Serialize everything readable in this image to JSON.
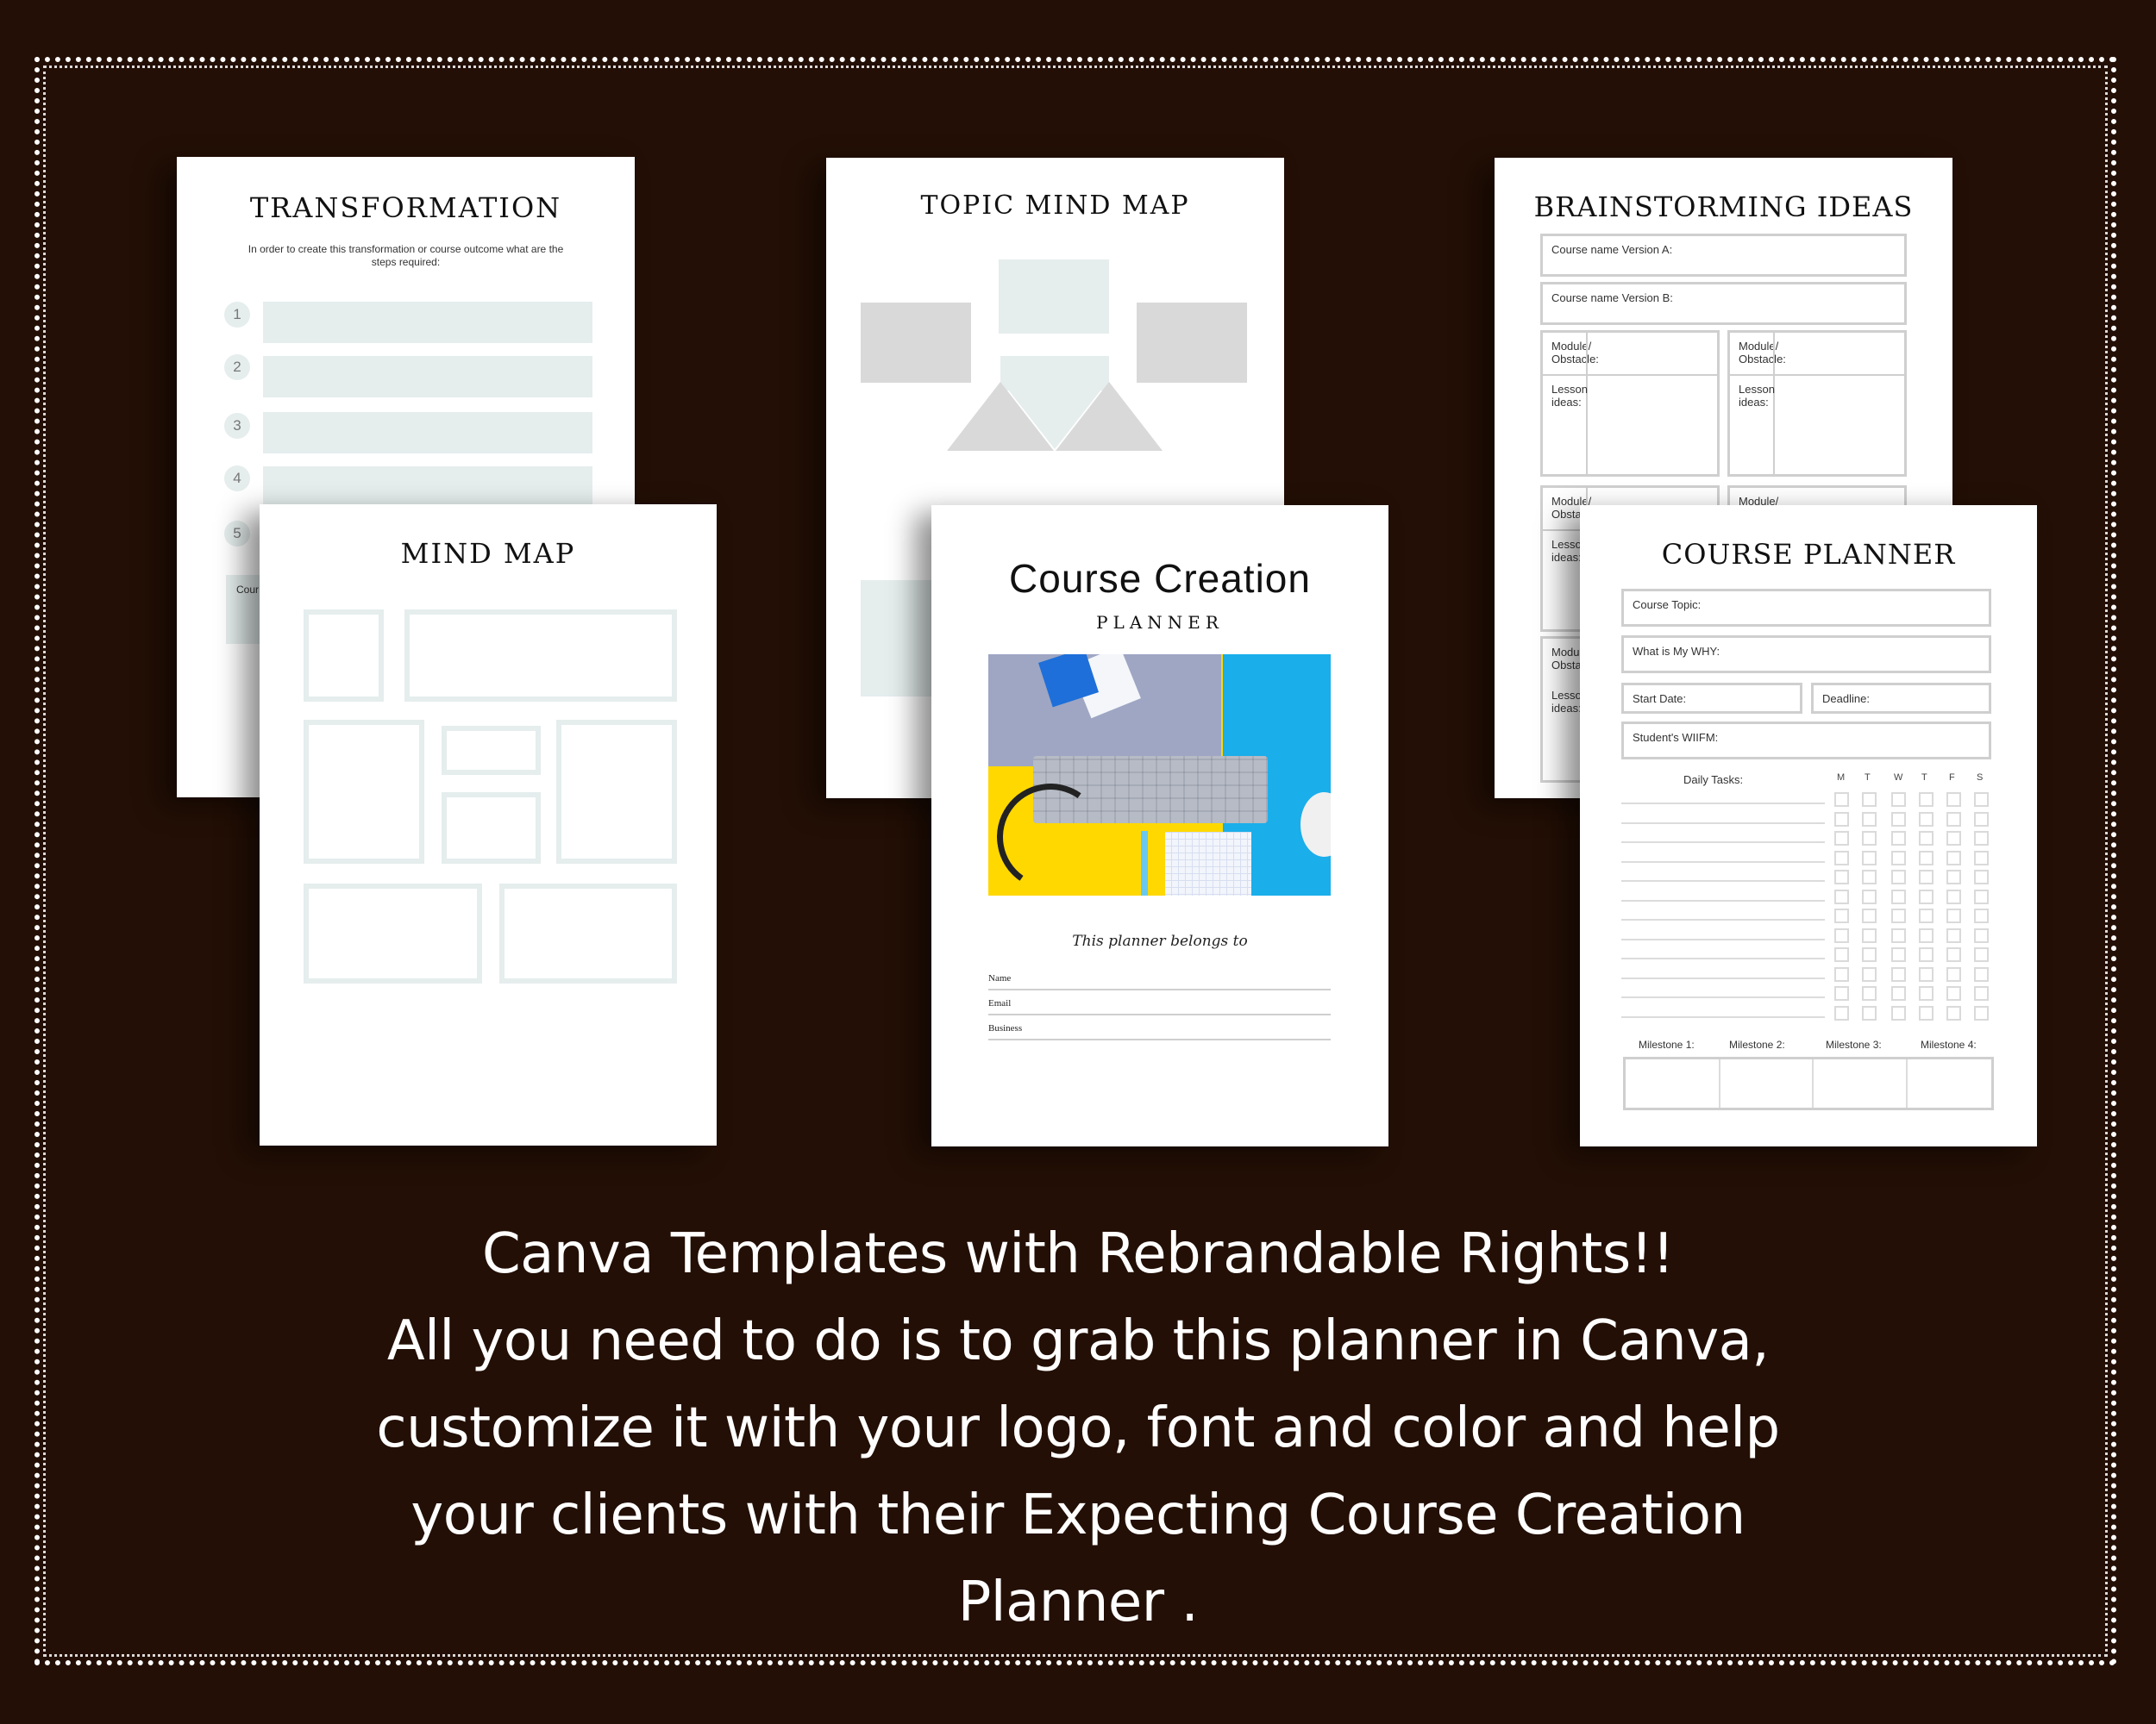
{
  "transformation": {
    "title": "TRANSFORMATION",
    "subtitle": "In order to create this transformation or course outcome what are the steps required:",
    "steps": [
      "1",
      "2",
      "3",
      "4",
      "5"
    ],
    "partial_label": "Cour"
  },
  "topic_mind_map": {
    "title": "TOPIC MIND MAP"
  },
  "brainstorming": {
    "title": "BRAINSTORMING IDEAS",
    "version_a": "Course name Version A:",
    "version_b": "Course name Version B:",
    "module_label": "Module/ Obstacle:",
    "lesson_label": "Lesson ideas:"
  },
  "mind_map": {
    "title": "MIND MAP"
  },
  "cover": {
    "title": "Course Creation",
    "subtitle": "PLANNER",
    "image_alt": "desk-photo-keyboard-headphones-notepads",
    "belongs": "This planner belongs to",
    "fields": [
      "Name",
      "Email",
      "Business"
    ]
  },
  "course_planner": {
    "title": "COURSE PLANNER",
    "course_topic": "Course Topic:",
    "why": "What is My WHY:",
    "start_date": "Start Date:",
    "deadline": "Deadline:",
    "wiifm": "Student's WIIFM:",
    "daily_tasks": "Daily Tasks:",
    "days": [
      "M",
      "T",
      "W",
      "T",
      "F",
      "S"
    ],
    "milestones": [
      "Milestone 1:",
      "Milestone 2:",
      "Milestone 3:",
      "Milestone 4:"
    ]
  },
  "caption": {
    "lines": [
      "Canva Templates with Rebrandable Rights!!",
      "All you need to do is to grab this planner in Canva,",
      "customize it with your logo, font and color and help",
      "your clients with their Expecting Course Creation",
      "Planner  ."
    ]
  },
  "colors": {
    "background": "#230f05",
    "accent_fill": "#e5eded",
    "grey_fill": "#d9d9d9"
  }
}
